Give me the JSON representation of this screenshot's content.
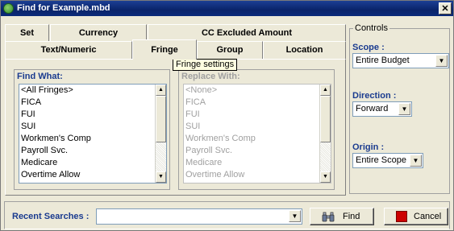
{
  "window": {
    "title": "Find for Example.mbd",
    "close_glyph": "✕"
  },
  "tabs": {
    "row1": [
      {
        "label": "Set"
      },
      {
        "label": "Currency"
      },
      {
        "label": "CC Excluded Amount"
      }
    ],
    "row2": [
      {
        "label": "Text/Numeric"
      },
      {
        "label": "Fringe"
      },
      {
        "label": "Group"
      },
      {
        "label": "Location"
      }
    ],
    "active": "Fringe"
  },
  "tooltip": {
    "text": "Fringe settings"
  },
  "find_what": {
    "label": "Find What:",
    "items": [
      "<All Fringes>",
      "FICA",
      "FUI",
      "SUI",
      "Workmen's Comp",
      "Payroll Svc.",
      "Medicare",
      "Overtime Allow"
    ]
  },
  "replace_with": {
    "label": "Replace With:",
    "items": [
      "<None>",
      "FICA",
      "FUI",
      "SUI",
      "Workmen's Comp",
      "Payroll Svc.",
      "Medicare",
      "Overtime Allow"
    ]
  },
  "controls": {
    "title": "Controls",
    "scope": {
      "label": "Scope :",
      "value": "Entire Budget"
    },
    "direction": {
      "label": "Direction :",
      "value": "Forward"
    },
    "origin": {
      "label": "Origin :",
      "value": "Entire Scope"
    }
  },
  "footer": {
    "recent_label": "Recent Searches :",
    "recent_value": "",
    "find_label": "Find",
    "cancel_label": "Cancel"
  },
  "icons": {
    "app": "app-icon",
    "find": "binoculars-icon",
    "cancel": "red-square-icon",
    "dropdown": "chevron-down-icon"
  },
  "colors": {
    "titlebar": "#0a246a",
    "label_blue": "#1a3b8f",
    "cancel_red": "#cc0000",
    "tooltip_bg": "#ffffe1"
  }
}
